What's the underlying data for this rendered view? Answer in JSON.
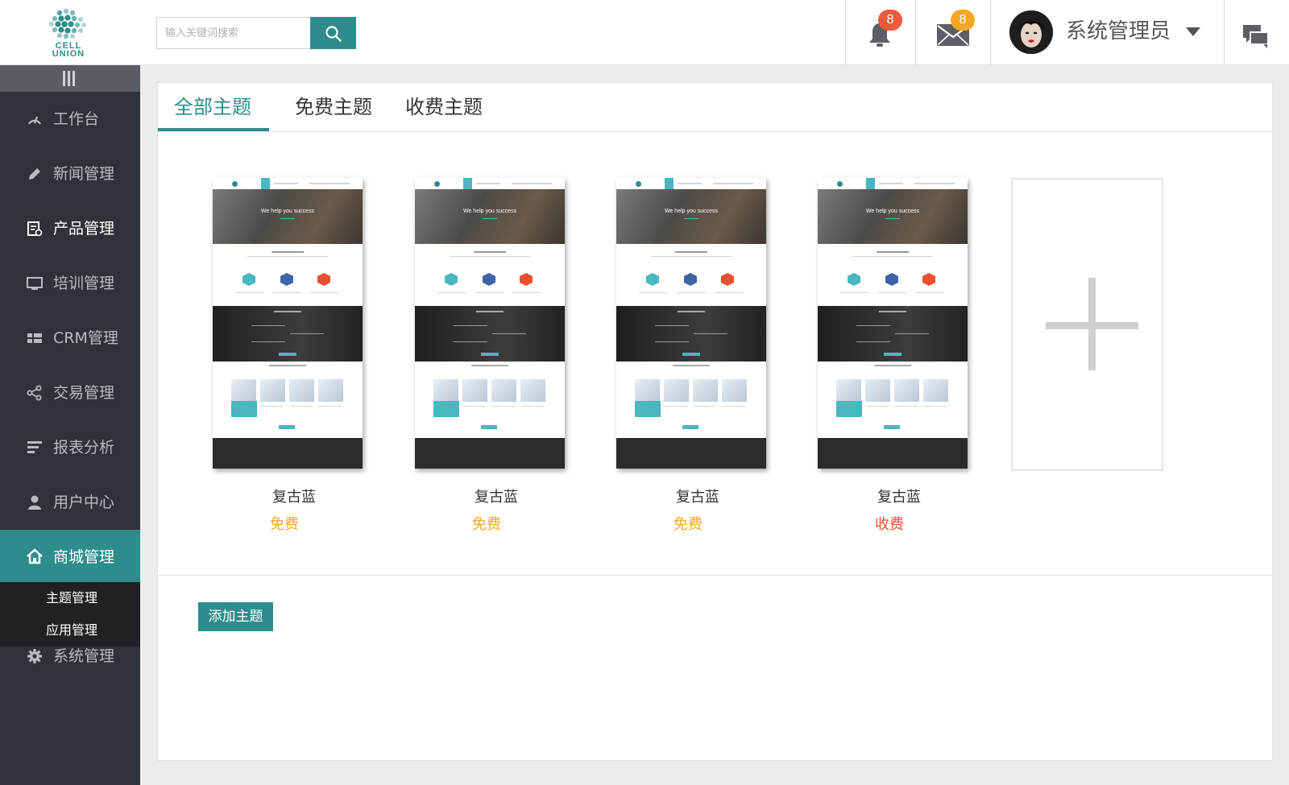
{
  "brand": {
    "logo_text_line1": "CELL",
    "logo_text_line2": "UNION",
    "accent": "#2e8c8c"
  },
  "header": {
    "search_placeholder": "输入关键词搜索",
    "notifications_count": "8",
    "messages_count": "8",
    "user_name": "系统管理员",
    "icons": [
      "search-icon",
      "bell-icon",
      "mail-icon",
      "caret-down-icon",
      "chat-icon"
    ]
  },
  "sidebar": {
    "items": [
      {
        "label": "工作台",
        "icon": "gauge-icon"
      },
      {
        "label": "新闻管理",
        "icon": "pencil-icon"
      },
      {
        "label": "产品管理",
        "icon": "product-icon"
      },
      {
        "label": "培训管理",
        "icon": "monitor-icon"
      },
      {
        "label": "CRM管理",
        "icon": "grid-icon"
      },
      {
        "label": "交易管理",
        "icon": "share-icon"
      },
      {
        "label": "报表分析",
        "icon": "report-icon"
      },
      {
        "label": "用户中心",
        "icon": "user-icon"
      },
      {
        "label": "商城管理",
        "icon": "home-icon"
      },
      {
        "label": "系统管理",
        "icon": "gear-icon"
      }
    ],
    "submenu": [
      {
        "label": "主题管理"
      },
      {
        "label": "应用管理"
      }
    ]
  },
  "main": {
    "tabs": [
      {
        "label": "全部主题"
      },
      {
        "label": "免费主题"
      },
      {
        "label": "收费主题"
      }
    ],
    "themes": [
      {
        "name": "复古蓝",
        "price": "免费",
        "price_color": "#f5a623"
      },
      {
        "name": "复古蓝",
        "price": "免费",
        "price_color": "#f5a623"
      },
      {
        "name": "复古蓝",
        "price": "免费",
        "price_color": "#f5a623"
      },
      {
        "name": "复古蓝",
        "price": "收费",
        "price_color": "#e8502f"
      }
    ],
    "thumbnail": {
      "hero_text": "We help you success"
    },
    "add_button": "添加主题"
  }
}
